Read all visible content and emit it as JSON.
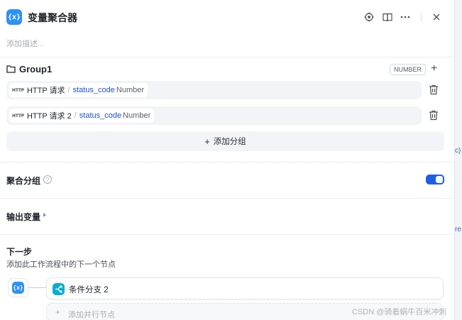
{
  "header": {
    "node_icon_text": "{x}",
    "title": "变量聚合器",
    "icons": [
      "target-icon",
      "book-icon",
      "more-icon",
      "close-icon"
    ],
    "description_placeholder": "添加描述..."
  },
  "group": {
    "name": "Group1",
    "type_badge": "NUMBER",
    "variables": [
      {
        "node": "HTTP 请求",
        "separator": "/",
        "variable": "status_code",
        "type": "Number"
      },
      {
        "node": "HTTP 请求 2",
        "separator": "/",
        "variable": "status_code",
        "type": "Number"
      }
    ],
    "add_group_label": "添加分组"
  },
  "aggregate_group": {
    "label": "聚合分组",
    "enabled": true
  },
  "output_vars": {
    "label": "输出变量"
  },
  "next_step": {
    "title": "下一步",
    "subtitle": "添加此工作流程中的下一个节点",
    "source_icon_text": "{x}",
    "target_label": "条件分支 2",
    "add_parallel_label": "添加并行节点"
  },
  "watermark": "CSDN @骑着蜗牛百米冲刺",
  "colors": {
    "accent": "#2e90fa",
    "toggle_on": "#1d5ee6",
    "variable_link": "#1d4fd7",
    "branch_icon": "#06aed4"
  }
}
